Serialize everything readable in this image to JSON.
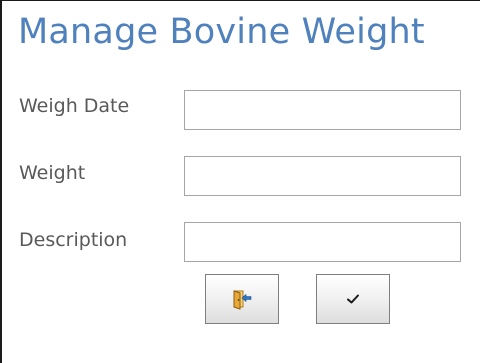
{
  "form": {
    "title": "Manage Bovine Weight",
    "fields": [
      {
        "label": "Weigh Date",
        "value": "",
        "placeholder": ""
      },
      {
        "label": "Weight",
        "value": "",
        "placeholder": ""
      },
      {
        "label": "Description",
        "value": "",
        "placeholder": ""
      }
    ],
    "buttons": [
      {
        "name": "close-form-button",
        "icon": "exit-door-icon"
      },
      {
        "name": "save-button",
        "icon": "checkmark-icon"
      }
    ],
    "colors": {
      "title": "#4f81bd",
      "label": "#595959",
      "field_border": "#a6a6a6",
      "door_icon": "#e8a93a",
      "arrow_icon": "#2f78c4"
    }
  }
}
